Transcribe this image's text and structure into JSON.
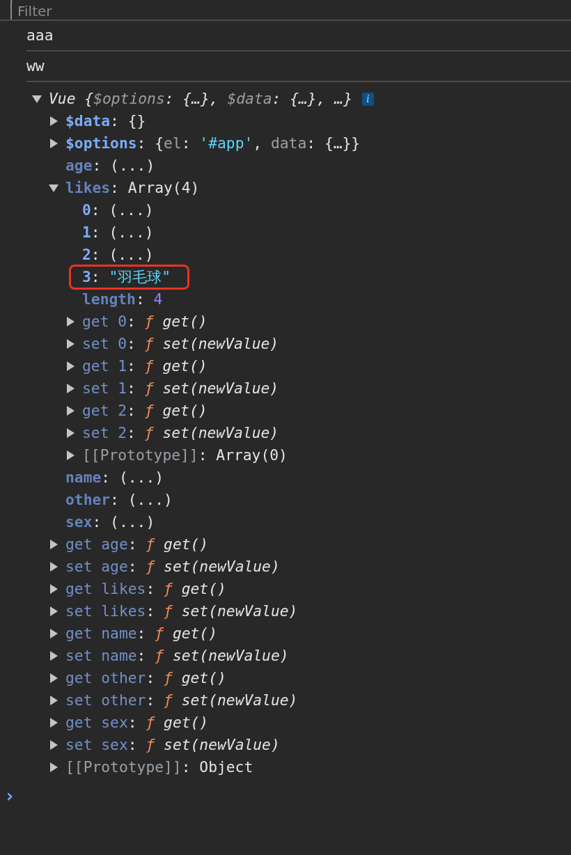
{
  "filter": {
    "placeholder": "Filter"
  },
  "logs": [
    "aaa",
    "ww"
  ],
  "object": {
    "expanded": true,
    "summary": [
      {
        "text": "Vue ",
        "kind": "italic"
      },
      {
        "text": "{",
        "kind": "italic"
      },
      {
        "text": "$options",
        "kind": "dim-italic"
      },
      {
        "text": ": {…}, ",
        "kind": "italic"
      },
      {
        "text": "$data",
        "kind": "dim-italic"
      },
      {
        "text": ": {…}, …}",
        "kind": "italic"
      }
    ],
    "info_badge": "i",
    "children": [
      {
        "key": "$data",
        "kind": "enumerable",
        "expanded": false,
        "value": [
          {
            "text": ": {}",
            "kind": "plain"
          }
        ]
      },
      {
        "key": "$options",
        "kind": "enumerable",
        "expanded": false,
        "value": [
          {
            "text": ": {",
            "kind": "plain"
          },
          {
            "text": "el",
            "kind": "dim"
          },
          {
            "text": ": ",
            "kind": "plain"
          },
          {
            "text": "'#app'",
            "kind": "string"
          },
          {
            "text": ", ",
            "kind": "plain"
          },
          {
            "text": "data",
            "kind": "dim"
          },
          {
            "text": ": {…}}",
            "kind": "plain"
          }
        ]
      },
      {
        "key": "age",
        "kind": "lazy",
        "value": [
          {
            "text": ": (...)",
            "kind": "plain"
          }
        ]
      },
      {
        "key": "likes",
        "kind": "lazy",
        "expanded": true,
        "value": [
          {
            "text": ": Array(4)",
            "kind": "plain"
          }
        ],
        "children": [
          {
            "key": "0",
            "kind": "enumerable",
            "value": [
              {
                "text": ": (...)",
                "kind": "plain"
              }
            ]
          },
          {
            "key": "1",
            "kind": "enumerable",
            "value": [
              {
                "text": ": (...)",
                "kind": "plain"
              }
            ]
          },
          {
            "key": "2",
            "kind": "enumerable",
            "value": [
              {
                "text": ": (...)",
                "kind": "plain"
              }
            ]
          },
          {
            "key": "3",
            "kind": "enumerable",
            "highlighted": true,
            "value": [
              {
                "text": ": ",
                "kind": "plain"
              },
              {
                "text": "\"羽毛球\"",
                "kind": "string"
              }
            ]
          },
          {
            "key": "length",
            "kind": "lazy",
            "value": [
              {
                "text": ": ",
                "kind": "plain"
              },
              {
                "text": "4",
                "kind": "number"
              }
            ]
          },
          {
            "key": "get 0",
            "kind": "accessor",
            "expanded": false,
            "value": [
              {
                "text": ": ",
                "kind": "plain"
              },
              {
                "text": "ƒ",
                "kind": "fn"
              },
              {
                "text": " get()",
                "kind": "italic"
              }
            ]
          },
          {
            "key": "set 0",
            "kind": "accessor",
            "expanded": false,
            "value": [
              {
                "text": ": ",
                "kind": "plain"
              },
              {
                "text": "ƒ",
                "kind": "fn"
              },
              {
                "text": " set(newValue)",
                "kind": "italic"
              }
            ]
          },
          {
            "key": "get 1",
            "kind": "accessor",
            "expanded": false,
            "value": [
              {
                "text": ": ",
                "kind": "plain"
              },
              {
                "text": "ƒ",
                "kind": "fn"
              },
              {
                "text": " get()",
                "kind": "italic"
              }
            ]
          },
          {
            "key": "set 1",
            "kind": "accessor",
            "expanded": false,
            "value": [
              {
                "text": ": ",
                "kind": "plain"
              },
              {
                "text": "ƒ",
                "kind": "fn"
              },
              {
                "text": " set(newValue)",
                "kind": "italic"
              }
            ]
          },
          {
            "key": "get 2",
            "kind": "accessor",
            "expanded": false,
            "value": [
              {
                "text": ": ",
                "kind": "plain"
              },
              {
                "text": "ƒ",
                "kind": "fn"
              },
              {
                "text": " get()",
                "kind": "italic"
              }
            ]
          },
          {
            "key": "set 2",
            "kind": "accessor",
            "expanded": false,
            "value": [
              {
                "text": ": ",
                "kind": "plain"
              },
              {
                "text": "ƒ",
                "kind": "fn"
              },
              {
                "text": " set(newValue)",
                "kind": "italic"
              }
            ]
          },
          {
            "key": "[[Prototype]]",
            "kind": "internal",
            "expanded": false,
            "value": [
              {
                "text": ": Array(0)",
                "kind": "plain"
              }
            ]
          }
        ]
      },
      {
        "key": "name",
        "kind": "lazy",
        "value": [
          {
            "text": ": (...)",
            "kind": "plain"
          }
        ]
      },
      {
        "key": "other",
        "kind": "lazy",
        "value": [
          {
            "text": ": (...)",
            "kind": "plain"
          }
        ]
      },
      {
        "key": "sex",
        "kind": "lazy",
        "value": [
          {
            "text": ": (...)",
            "kind": "plain"
          }
        ]
      },
      {
        "key": "get age",
        "kind": "accessor",
        "expanded": false,
        "value": [
          {
            "text": ": ",
            "kind": "plain"
          },
          {
            "text": "ƒ",
            "kind": "fn"
          },
          {
            "text": " get()",
            "kind": "italic"
          }
        ]
      },
      {
        "key": "set age",
        "kind": "accessor",
        "expanded": false,
        "value": [
          {
            "text": ": ",
            "kind": "plain"
          },
          {
            "text": "ƒ",
            "kind": "fn"
          },
          {
            "text": " set(newValue)",
            "kind": "italic"
          }
        ]
      },
      {
        "key": "get likes",
        "kind": "accessor",
        "expanded": false,
        "value": [
          {
            "text": ": ",
            "kind": "plain"
          },
          {
            "text": "ƒ",
            "kind": "fn"
          },
          {
            "text": " get()",
            "kind": "italic"
          }
        ]
      },
      {
        "key": "set likes",
        "kind": "accessor",
        "expanded": false,
        "value": [
          {
            "text": ": ",
            "kind": "plain"
          },
          {
            "text": "ƒ",
            "kind": "fn"
          },
          {
            "text": " set(newValue)",
            "kind": "italic"
          }
        ]
      },
      {
        "key": "get name",
        "kind": "accessor",
        "expanded": false,
        "value": [
          {
            "text": ": ",
            "kind": "plain"
          },
          {
            "text": "ƒ",
            "kind": "fn"
          },
          {
            "text": " get()",
            "kind": "italic"
          }
        ]
      },
      {
        "key": "set name",
        "kind": "accessor",
        "expanded": false,
        "value": [
          {
            "text": ": ",
            "kind": "plain"
          },
          {
            "text": "ƒ",
            "kind": "fn"
          },
          {
            "text": " set(newValue)",
            "kind": "italic"
          }
        ]
      },
      {
        "key": "get other",
        "kind": "accessor",
        "expanded": false,
        "value": [
          {
            "text": ": ",
            "kind": "plain"
          },
          {
            "text": "ƒ",
            "kind": "fn"
          },
          {
            "text": " get()",
            "kind": "italic"
          }
        ]
      },
      {
        "key": "set other",
        "kind": "accessor",
        "expanded": false,
        "value": [
          {
            "text": ": ",
            "kind": "plain"
          },
          {
            "text": "ƒ",
            "kind": "fn"
          },
          {
            "text": " set(newValue)",
            "kind": "italic"
          }
        ]
      },
      {
        "key": "get sex",
        "kind": "accessor",
        "expanded": false,
        "value": [
          {
            "text": ": ",
            "kind": "plain"
          },
          {
            "text": "ƒ",
            "kind": "fn"
          },
          {
            "text": " get()",
            "kind": "italic"
          }
        ]
      },
      {
        "key": "set sex",
        "kind": "accessor",
        "expanded": false,
        "value": [
          {
            "text": ": ",
            "kind": "plain"
          },
          {
            "text": "ƒ",
            "kind": "fn"
          },
          {
            "text": " set(newValue)",
            "kind": "italic"
          }
        ]
      },
      {
        "key": "[[Prototype]]",
        "kind": "internal",
        "expanded": false,
        "value": [
          {
            "text": ": Object",
            "kind": "plain"
          }
        ]
      }
    ]
  },
  "prompt": "›"
}
